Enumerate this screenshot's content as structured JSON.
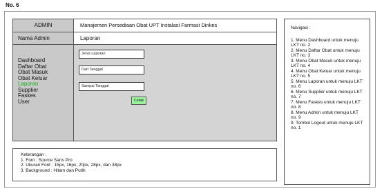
{
  "sheet_title": "No. 6",
  "header": {
    "role": "ADMIN",
    "app_title": "Manajemen Persediaan Obat UPT Instalasi Farmasi Dinkes"
  },
  "sidebar": {
    "user_name": "Nama Admin",
    "items": [
      {
        "label": "Dashboard",
        "active": false
      },
      {
        "label": "Daftar Obat",
        "active": false
      },
      {
        "label": "Obat Masuk",
        "active": false
      },
      {
        "label": "Obat Keluar",
        "active": false
      },
      {
        "label": "Laporan",
        "active": true
      },
      {
        "label": "Supplier",
        "active": false
      },
      {
        "label": "Faskes",
        "active": false
      },
      {
        "label": "User",
        "active": false
      }
    ],
    "active_color": "#1aa81a"
  },
  "main": {
    "title": "Laporan",
    "fields": {
      "report_type": {
        "placeholder": "Jenis Laporan"
      },
      "date_from": {
        "placeholder": "Dari Tanggal"
      },
      "date_to": {
        "placeholder": "Sampai Tanggal"
      }
    },
    "print_button": "Cetak",
    "print_button_color": "#9cf59c"
  },
  "notes": {
    "heading": "Keterangan :",
    "lines": [
      "1. Font : Source Sans Pro",
      "2. Ukuran Font : 15px, 16px, 20px, 28px, dan 38px",
      "3. Background : Hitam dan Putih"
    ]
  },
  "navigation": {
    "title": "Navigasi :",
    "items": [
      "1. Menu Dashboard untuk menuju LKT no. 2",
      "2. Menu Daftar Obat untuk menuju LKT no. 3",
      "3. Menu Obat Masuk untuk menuju LKT no. 4",
      "4. Menu Obat Keluar untuk menuju LKT no. 5",
      "5. Menu Laporan untuk menuju LKT no. 6",
      "6. Menu Supplier untuk menuju LKT no. 7",
      "7. Menu Faskes untuk menuju LKT no. 8",
      "8. Menu Admin untuk menuju LKT no. 9",
      "9. Tombol Logout untuk menuju LKT no. 1"
    ]
  }
}
